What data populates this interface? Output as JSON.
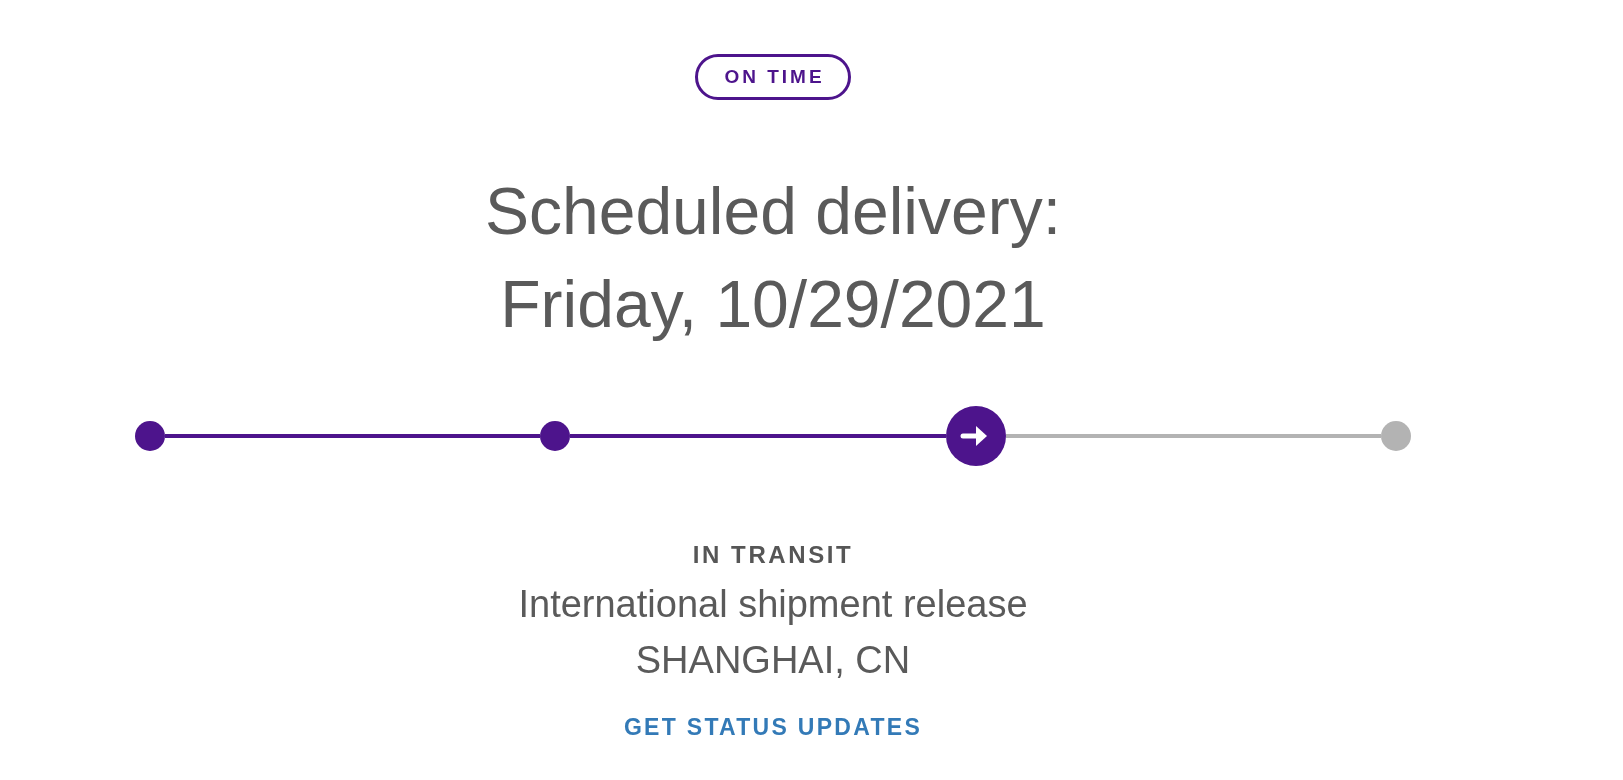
{
  "badge": {
    "label": "ON TIME"
  },
  "delivery": {
    "heading": "Scheduled delivery:",
    "date": "Friday, 10/29/2021"
  },
  "progress": {
    "steps": [
      {
        "kind": "done"
      },
      {
        "kind": "done"
      },
      {
        "kind": "current"
      },
      {
        "kind": "pending"
      }
    ]
  },
  "status": {
    "title": "IN TRANSIT",
    "description": "International shipment release",
    "location": "SHANGHAI, CN"
  },
  "link": {
    "label": "GET STATUS UPDATES"
  }
}
